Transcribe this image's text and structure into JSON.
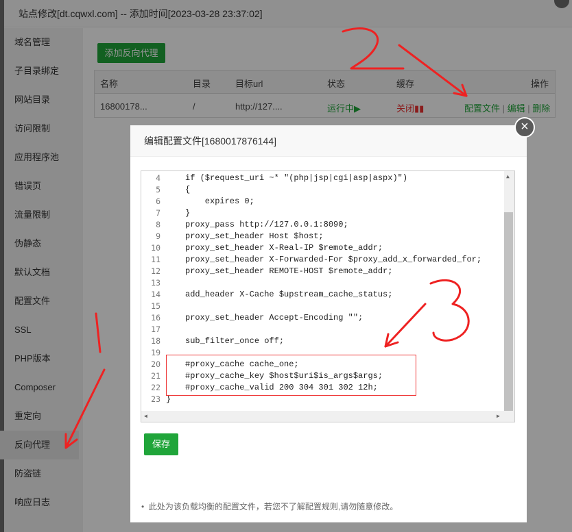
{
  "outer_dialog": {
    "title": "站点修改[dt.cqwxl.com] -- 添加时间[2023-03-28 23:37:02]"
  },
  "sidebar": {
    "items": [
      {
        "label": "域名管理"
      },
      {
        "label": "子目录绑定"
      },
      {
        "label": "网站目录"
      },
      {
        "label": "访问限制"
      },
      {
        "label": "应用程序池"
      },
      {
        "label": "错误页"
      },
      {
        "label": "流量限制"
      },
      {
        "label": "伪静态"
      },
      {
        "label": "默认文档"
      },
      {
        "label": "配置文件"
      },
      {
        "label": "SSL"
      },
      {
        "label": "PHP版本"
      },
      {
        "label": "Composer"
      },
      {
        "label": "重定向"
      },
      {
        "label": "反向代理",
        "active": true
      },
      {
        "label": "防盗链"
      },
      {
        "label": "响应日志"
      }
    ]
  },
  "proxy": {
    "add_button": "添加反向代理",
    "columns": [
      "名称",
      "目录",
      "目标url",
      "状态",
      "缓存",
      "操作"
    ],
    "row": {
      "name": "16800178...",
      "dir": "/",
      "target": "http://127....",
      "status": "运行中▶",
      "cache": "关闭▮▮",
      "action_config": "配置文件",
      "action_sep": " | ",
      "action_edit": "编辑",
      "action_delete": "删除"
    }
  },
  "editor_dialog": {
    "title": "编辑配置文件[1680017876144]",
    "close_icon": "×",
    "save_button": "保存",
    "note": "此处为该负载均衡的配置文件，若您不了解配置规则,请勿随意修改。",
    "lines": [
      {
        "n": "4",
        "text": "if ($request_uri ~* \"(php|jsp|cgi|asp|aspx)\")"
      },
      {
        "n": "5",
        "text": "{"
      },
      {
        "n": "6",
        "text": "    expires 0;"
      },
      {
        "n": "7",
        "text": "}"
      },
      {
        "n": "8",
        "text": "proxy_pass http://127.0.0.1:8090;"
      },
      {
        "n": "9",
        "text": "proxy_set_header Host $host;"
      },
      {
        "n": "10",
        "text": "proxy_set_header X-Real-IP $remote_addr;"
      },
      {
        "n": "11",
        "text": "proxy_set_header X-Forwarded-For $proxy_add_x_forwarded_for;"
      },
      {
        "n": "12",
        "text": "proxy_set_header REMOTE-HOST $remote_addr;"
      },
      {
        "n": "13",
        "text": ""
      },
      {
        "n": "14",
        "text": "add_header X-Cache $upstream_cache_status;"
      },
      {
        "n": "15",
        "text": ""
      },
      {
        "n": "16",
        "text": "proxy_set_header Accept-Encoding \"\";"
      },
      {
        "n": "17",
        "text": ""
      },
      {
        "n": "18",
        "text": "sub_filter_once off;"
      },
      {
        "n": "19",
        "text": ""
      },
      {
        "n": "20",
        "text": "#proxy_cache cache_one;"
      },
      {
        "n": "21",
        "text": "#proxy_cache_key $host$uri$is_args$args;"
      },
      {
        "n": "22",
        "text": "#proxy_cache_valid 200 304 301 302 12h;"
      },
      {
        "n": "23",
        "text": "}"
      }
    ]
  },
  "annotations": {
    "color": "#ee2222"
  }
}
